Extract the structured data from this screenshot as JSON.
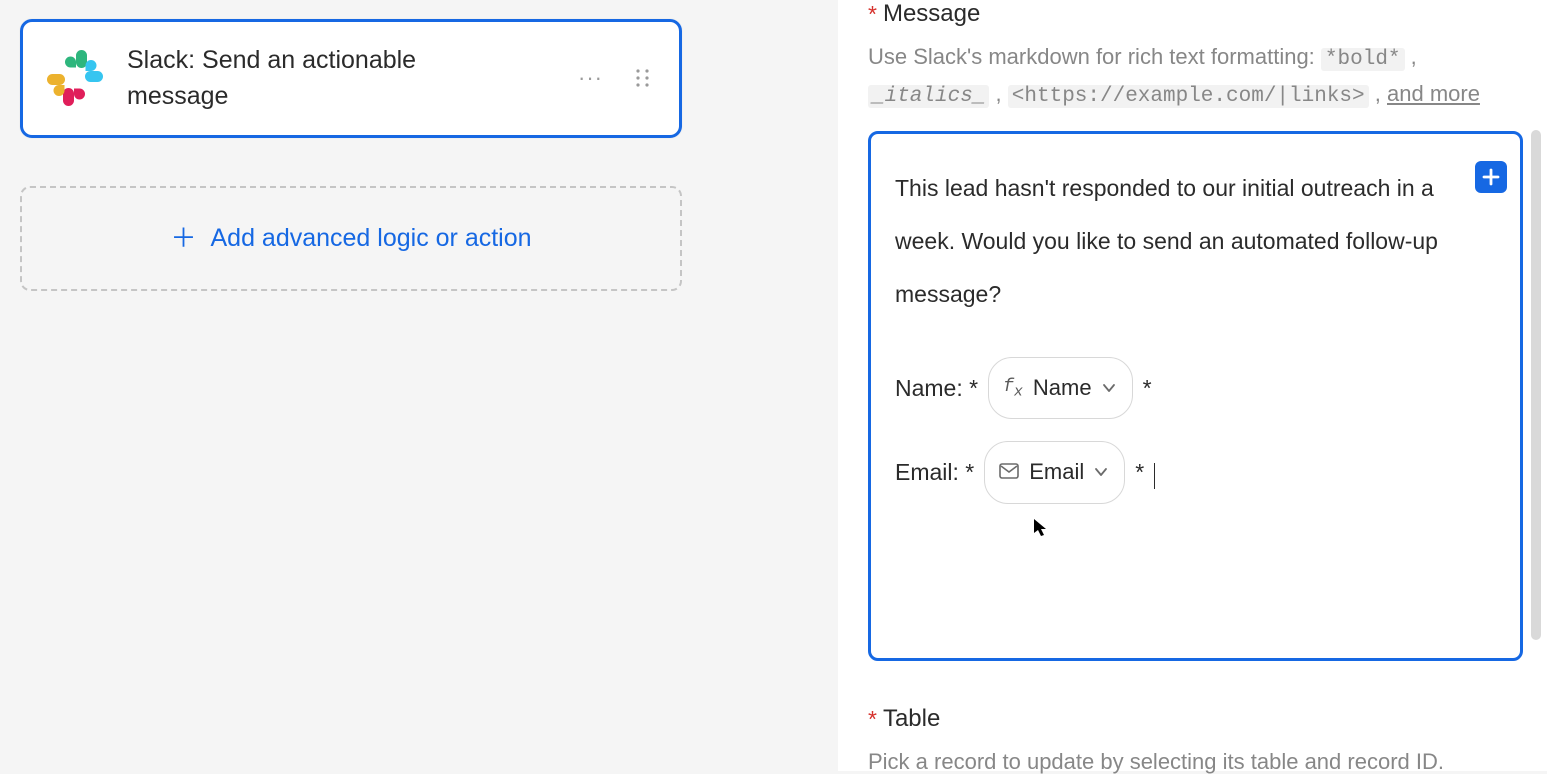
{
  "left": {
    "action_title": "Slack: Send an actionable message",
    "add_action_label": "Add advanced logic or action"
  },
  "right": {
    "message": {
      "label": "Message",
      "help_prefix": "Use Slack's markdown for rich text formatting: ",
      "help_bold": "*bold*",
      "help_sep1": " , ",
      "help_italics": "_italics_",
      "help_sep2": " ,  ",
      "help_links": "<https://example.com/|links>",
      "help_sep3": " , ",
      "help_more": "and more",
      "body_text": "This lead hasn't responded to our initial outreach in a week. Would you like to send an automated follow-up message?",
      "name_label": "Name: *",
      "name_token": "Name",
      "name_suffix": "*",
      "email_label": "Email: *",
      "email_token": "Email",
      "email_suffix": "*"
    },
    "table": {
      "label": "Table",
      "help": "Pick a record to update by selecting its table and record ID."
    }
  }
}
